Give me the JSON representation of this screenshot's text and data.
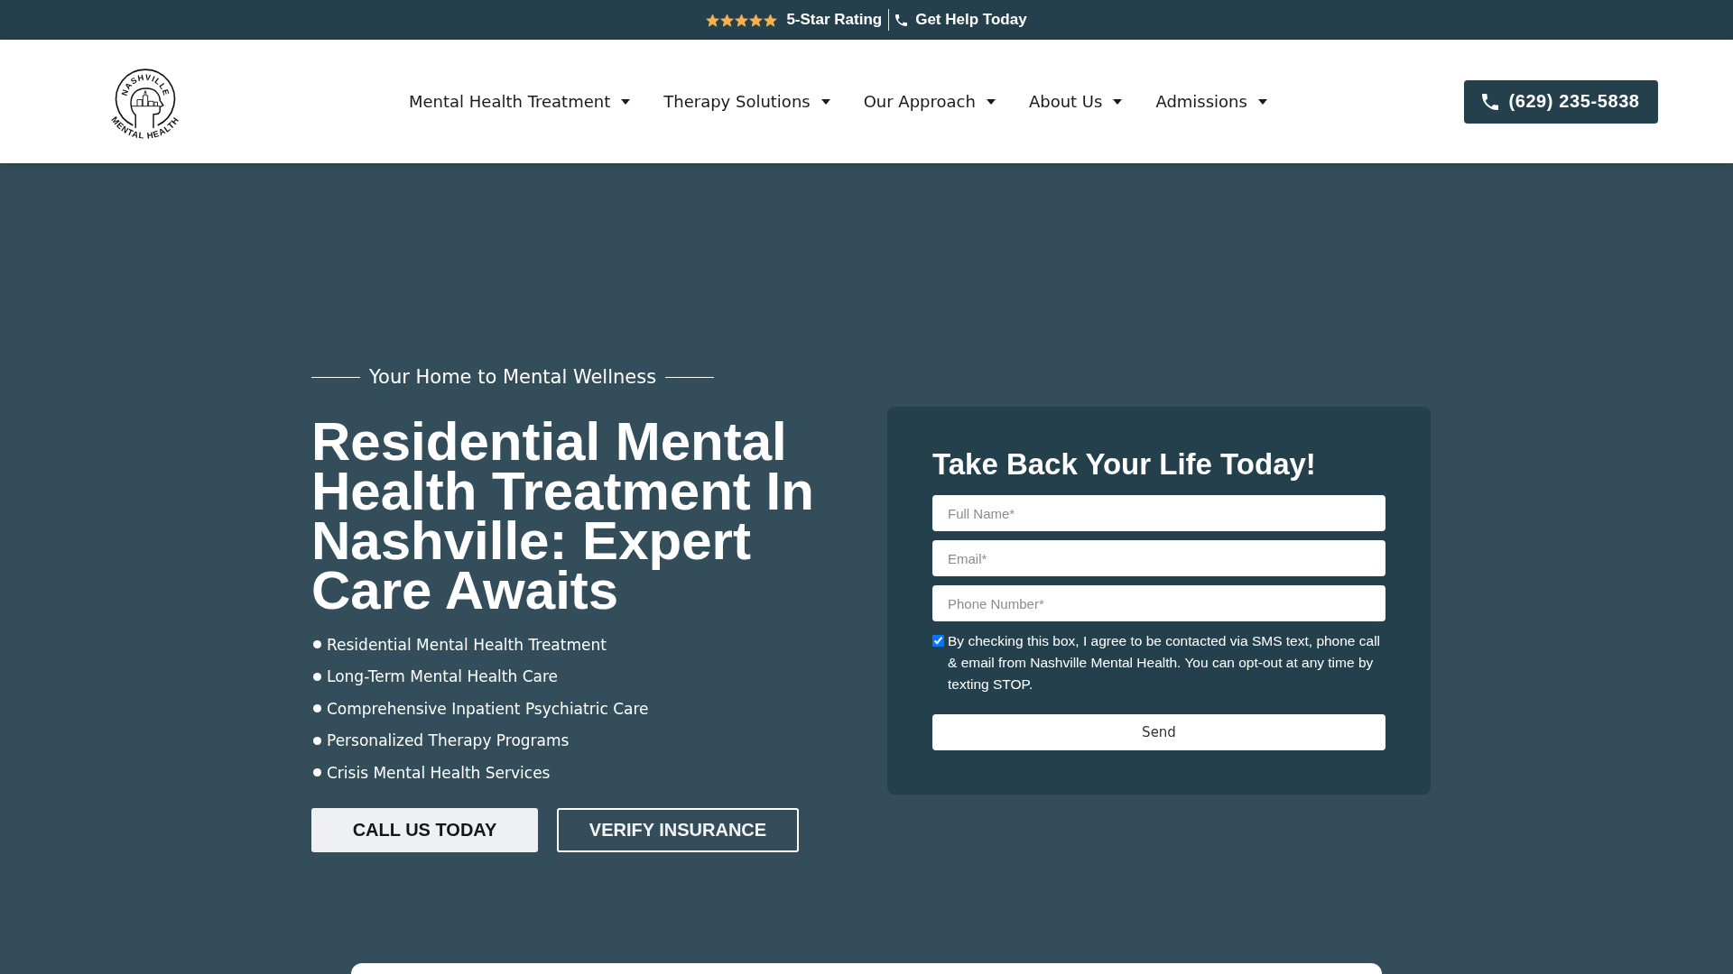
{
  "top_bar": {
    "stars": 5,
    "rating": "5-Star Rating",
    "help": "Get Help Today"
  },
  "header": {
    "logo": {
      "top_text": "NASHVILLE",
      "bottom_text": "MENTAL HEALTH"
    },
    "nav": [
      {
        "label": "Mental Health Treatment"
      },
      {
        "label": "Therapy Solutions"
      },
      {
        "label": "Our Approach"
      },
      {
        "label": "About Us"
      },
      {
        "label": "Admissions"
      }
    ],
    "phone": "(629) 235-5838"
  },
  "hero": {
    "tagline": "Your Home to Mental Wellness",
    "title": "Residential Mental Health Treatment In Nashville: Expert Care Awaits",
    "bullets": [
      "Residential Mental Health Treatment",
      "Long-Term Mental Health Care",
      "Comprehensive Inpatient Psychiatric Care",
      "Personalized Therapy Programs",
      "Crisis Mental Health Services"
    ],
    "buttons": [
      {
        "label": "CALL US TODAY",
        "kind": "filled"
      },
      {
        "label": "VERIFY INSURANCE",
        "kind": "outline"
      }
    ]
  },
  "form": {
    "title": "Take Back Your Life Today!",
    "fields": [
      {
        "placeholder": "Full Name*"
      },
      {
        "placeholder": "Email*"
      },
      {
        "placeholder": "Phone Number*"
      }
    ],
    "consent": {
      "checked": true,
      "text": "By checking this box, I agree to be contacted via SMS text, phone call & email from Nashville Mental Health. You can opt-out at any time by texting STOP."
    },
    "submit": "Send"
  }
}
